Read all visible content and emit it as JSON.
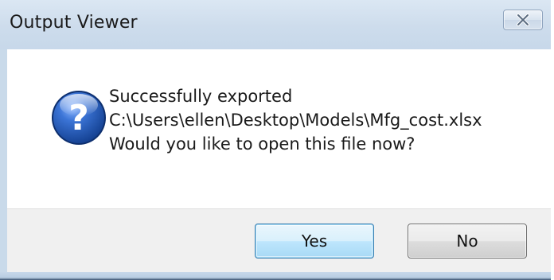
{
  "window": {
    "title": "Output Viewer"
  },
  "titlebar": {
    "close_icon": "close-x-icon"
  },
  "dialog": {
    "icon": "question-icon",
    "message_line1": "Successfully exported",
    "message_line2": "C:\\Users\\ellen\\Desktop\\Models\\Mfg_cost.xlsx",
    "message_line3": "Would you like to open this file now?"
  },
  "buttons": {
    "yes_label": "Yes",
    "no_label": "No"
  },
  "colors": {
    "frame": "#c9daea",
    "content_bg": "#ffffff",
    "footer_bg": "#f0f0f0",
    "icon_blue": "#1f57b5",
    "default_button_border": "#3c7fb1"
  }
}
